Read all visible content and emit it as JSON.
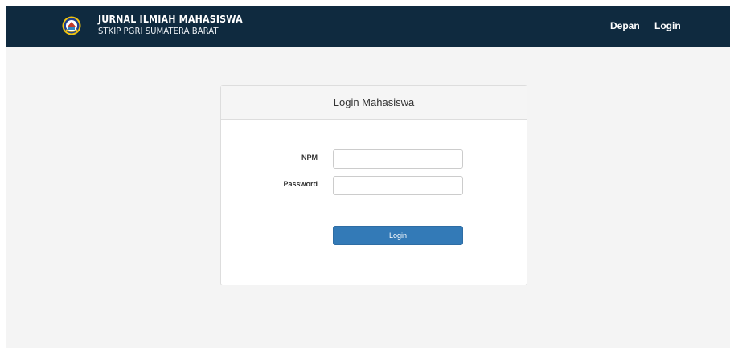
{
  "navbar": {
    "brand_title": "JURNAL ILMIAH MAHASISWA",
    "brand_subtitle": "STKIP PGRI SUMATERA BARAT",
    "links": [
      {
        "label": "Depan"
      },
      {
        "label": "Login"
      }
    ],
    "logo_icon": "university-emblem-icon",
    "background_color": "#0f2a3f"
  },
  "login_panel": {
    "title": "Login Mahasiswa",
    "fields": {
      "npm": {
        "label": "NPM",
        "value": "",
        "placeholder": ""
      },
      "password": {
        "label": "Password",
        "value": "",
        "placeholder": ""
      }
    },
    "submit_label": "Login",
    "button_color": "#337ab7"
  }
}
